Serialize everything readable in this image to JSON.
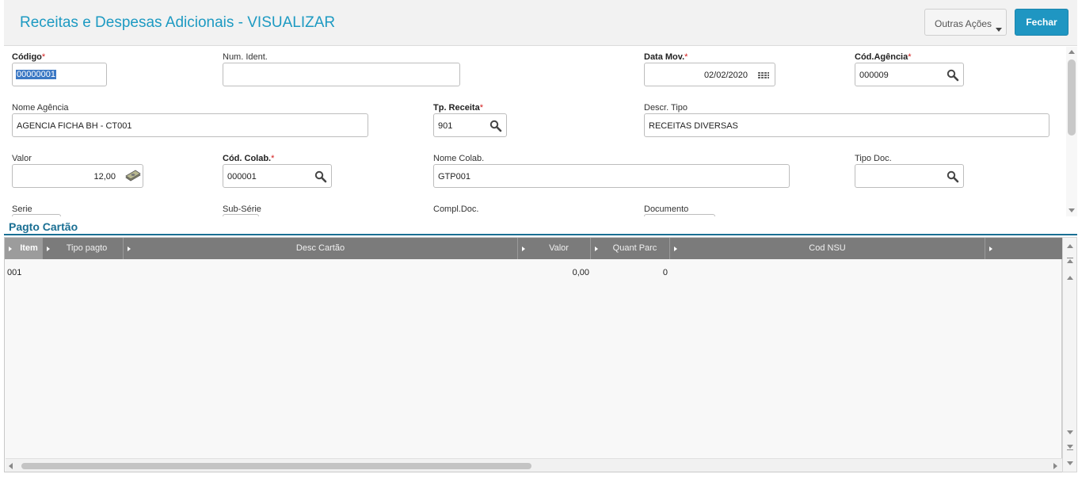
{
  "header": {
    "title": "Receitas e Despesas Adicionais - VISUALIZAR",
    "other_actions_label": "Outras Ações",
    "close_label": "Fechar"
  },
  "form": {
    "codigo": {
      "label": "Código",
      "value": "00000001"
    },
    "num_ident": {
      "label": "Num. Ident.",
      "value": ""
    },
    "data_mov": {
      "label": "Data Mov.",
      "value": "02/02/2020"
    },
    "cod_agencia": {
      "label": "Cód.Agência",
      "value": "000009"
    },
    "nome_agencia": {
      "label": "Nome Agência",
      "value": "AGENCIA FICHA BH - CT001"
    },
    "tp_receita": {
      "label": "Tp. Receita",
      "value": "901"
    },
    "descr_tipo": {
      "label": "Descr. Tipo",
      "value": "RECEITAS DIVERSAS"
    },
    "valor": {
      "label": "Valor",
      "value": "12,00"
    },
    "cod_colab": {
      "label": "Cód. Colab.",
      "value": "000001"
    },
    "nome_colab": {
      "label": "Nome Colab.",
      "value": "GTP001"
    },
    "tipo_doc": {
      "label": "Tipo Doc.",
      "value": ""
    },
    "serie": {
      "label": "Serie"
    },
    "sub_serie": {
      "label": "Sub-Série"
    },
    "compl_doc": {
      "label": "Compl.Doc."
    },
    "documento": {
      "label": "Documento"
    },
    "required_mark": "*"
  },
  "section": {
    "title": "Pagto Cartão"
  },
  "grid": {
    "columns": [
      "Item",
      "Tipo pagto",
      "Desc Cartão",
      "Valor",
      "Quant Parc",
      "Cod NSU"
    ],
    "rows": [
      {
        "item": "001",
        "tipo_pagto": "",
        "desc_cartao": "",
        "valor": "0,00",
        "quant_parc": "0",
        "cod_nsu": ""
      }
    ]
  },
  "icons": {
    "search": "magnifier-icon",
    "calendar": "calendar-icon",
    "money": "money-icon"
  },
  "colors": {
    "accent": "#1d9ac2",
    "primary_button": "#1f96c2",
    "section_title": "#1a6f93",
    "grid_header": "#7b7b7b",
    "required": "#d21b1b"
  }
}
